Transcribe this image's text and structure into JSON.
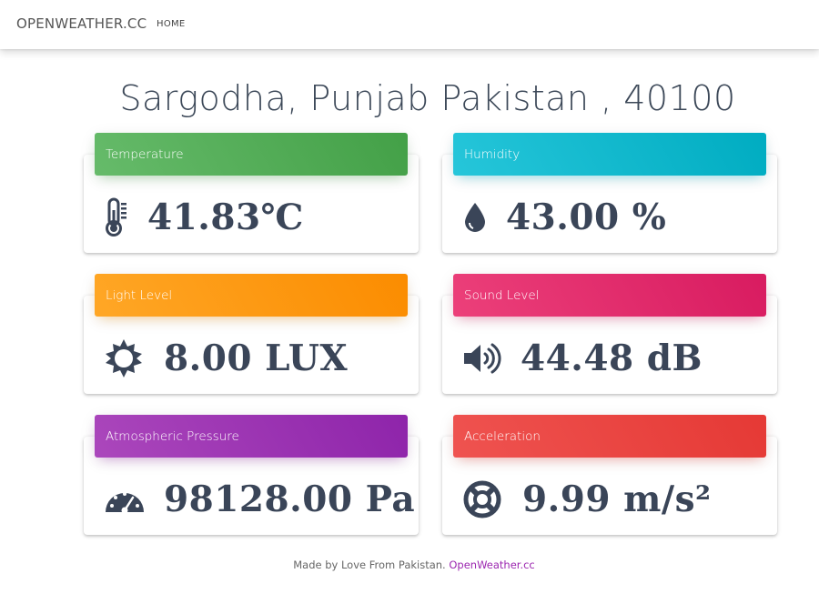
{
  "nav": {
    "brand": "OPENWEATHER.CC",
    "home": "HOME"
  },
  "location": "Sargodha, Punjab Pakistan , 40100",
  "cards": [
    {
      "label": "Temperature",
      "value": "41.83℃",
      "icon": "thermometer-icon",
      "gradient": [
        "#66bb6a",
        "#43a047"
      ],
      "shadow": "rgba(76,175,80,0.45)"
    },
    {
      "label": "Humidity",
      "value": "43.00 %",
      "icon": "water-drop-icon",
      "gradient": [
        "#26c6da",
        "#00acc1"
      ],
      "shadow": "rgba(0,188,212,0.45)"
    },
    {
      "label": "Light Level",
      "value": "8.00 LUX",
      "icon": "sun-icon",
      "gradient": [
        "#ffa726",
        "#fb8c00"
      ],
      "shadow": "rgba(255,152,0,0.45)"
    },
    {
      "label": "Sound Level",
      "value": "44.48 dB",
      "icon": "speaker-icon",
      "gradient": [
        "#ec407a",
        "#d81b60"
      ],
      "shadow": "rgba(233,30,99,0.45)"
    },
    {
      "label": "Atmospheric Pressure",
      "value": "98128.00 Pa",
      "icon": "gauge-icon",
      "gradient": [
        "#ab47bc",
        "#8e24aa"
      ],
      "shadow": "rgba(156,39,176,0.45)"
    },
    {
      "label": "Acceleration",
      "value": "9.99 m/s²",
      "icon": "lifebuoy-icon",
      "gradient": [
        "#ef5350",
        "#e53935"
      ],
      "shadow": "rgba(244,67,54,0.45)"
    }
  ],
  "footer": {
    "text": "Made by Love From Pakistan.",
    "link": "OpenWeather.cc"
  },
  "colors": {
    "text": "#3c4858",
    "link": "#9c27b0"
  }
}
